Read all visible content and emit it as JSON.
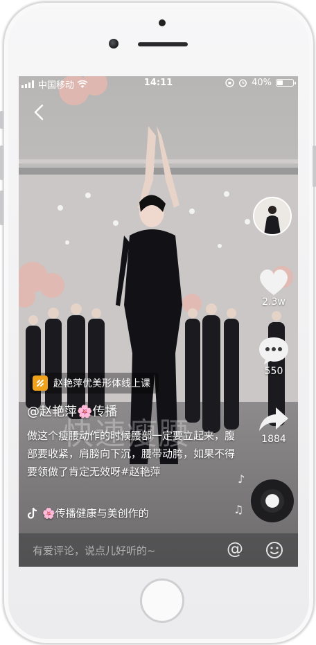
{
  "status_bar": {
    "carrier": "中国移动",
    "time": "14:11",
    "battery_percent": "40%",
    "battery_level": 0.4
  },
  "video": {
    "overlay_text": "快速瘦腰"
  },
  "right_bar": {
    "like_count": "2.3w",
    "comment_count": "550",
    "share_count": "1884"
  },
  "course_tag": {
    "label": "赵艳萍优美形体线上课"
  },
  "post": {
    "author": "@赵艳萍🌸传播",
    "caption": "做这个瘦腰动作的时候腰部一定要立起来，腹部要收紧，肩膀向下沉，腰带动胯，如果不得要领做了肯定无效呀#赵艳萍",
    "music": "🌸传播健康与美创作的"
  },
  "comment_bar": {
    "placeholder": "有爱评论，说点儿好听的~",
    "at_symbol": "@"
  },
  "icons": {
    "back": "back-arrow-icon",
    "like": "heart-icon",
    "comment": "comment-icon",
    "share": "share-icon",
    "music": "tiktok-note-icon",
    "emoji": "emoji-icon"
  }
}
